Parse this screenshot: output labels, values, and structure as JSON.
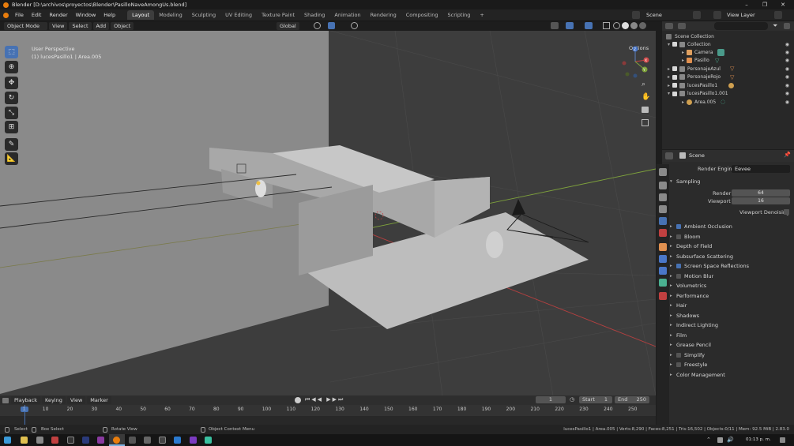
{
  "window": {
    "title": "Blender [D:\\archivos\\proyectos\\Blender\\PasilloNaveAmongUs.blend]",
    "controls": [
      "–",
      "❐",
      "✕"
    ]
  },
  "menubar": {
    "menus": [
      "File",
      "Edit",
      "Render",
      "Window",
      "Help"
    ],
    "workspaces": [
      "Layout",
      "Modeling",
      "Sculpting",
      "UV Editing",
      "Texture Paint",
      "Shading",
      "Animation",
      "Rendering",
      "Compositing",
      "Scripting"
    ],
    "active_workspace": "Layout",
    "add_tab": "+",
    "scene_name": "Scene",
    "view_layer": "View Layer"
  },
  "viewport": {
    "mode": "Object Mode",
    "menus": [
      "View",
      "Select",
      "Add",
      "Object"
    ],
    "transform_orientation": "Global",
    "options_label": "Options",
    "overlay_text_1": "User Perspective",
    "overlay_text_2": "(1) lucesPasillo1 | Area.005",
    "gizmo_axes": {
      "x": "X",
      "y": "Y",
      "z": "Z"
    }
  },
  "outliner": {
    "root": "Scene Collection",
    "rows": [
      {
        "name": "Collection",
        "indent": 1
      },
      {
        "name": "Camera",
        "indent": 2
      },
      {
        "name": "Pasillo",
        "indent": 2
      },
      {
        "name": "PersonajeAzul",
        "indent": 1
      },
      {
        "name": "PersonajeRojo",
        "indent": 1
      },
      {
        "name": "lucesPasillo1",
        "indent": 1
      },
      {
        "name": "lucesPasillo1.001",
        "indent": 1
      },
      {
        "name": "Area.005",
        "indent": 2
      }
    ]
  },
  "properties": {
    "header": "Scene",
    "render_engine_label": "Render Engine",
    "render_engine_value": "Eevee",
    "sampling_label": "Sampling",
    "render_label": "Render",
    "render_value": "64",
    "viewport_label": "Viewport",
    "viewport_value": "16",
    "viewport_denoising": "Viewport Denoising",
    "panels": [
      {
        "label": "Ambient Occlusion",
        "checkbox": true,
        "checked": true
      },
      {
        "label": "Bloom",
        "checkbox": true,
        "checked": false
      },
      {
        "label": "Depth of Field",
        "checkbox": false
      },
      {
        "label": "Subsurface Scattering",
        "checkbox": false
      },
      {
        "label": "Screen Space Reflections",
        "checkbox": true,
        "checked": true
      },
      {
        "label": "Motion Blur",
        "checkbox": true,
        "checked": false
      },
      {
        "label": "Volumetrics",
        "checkbox": false
      },
      {
        "label": "Performance",
        "checkbox": false
      },
      {
        "label": "Hair",
        "checkbox": false
      },
      {
        "label": "Shadows",
        "checkbox": false
      },
      {
        "label": "Indirect Lighting",
        "checkbox": false
      },
      {
        "label": "Film",
        "checkbox": false
      },
      {
        "label": "Grease Pencil",
        "checkbox": false
      },
      {
        "label": "Simplify",
        "checkbox": true,
        "checked": false
      },
      {
        "label": "Freestyle",
        "checkbox": true,
        "checked": false
      },
      {
        "label": "Color Management",
        "checkbox": false
      }
    ]
  },
  "timeline": {
    "menus": [
      "Playback",
      "Keying",
      "View",
      "Marker"
    ],
    "current_frame": "1",
    "start_label": "Start",
    "start_value": "1",
    "end_label": "End",
    "end_value": "250",
    "ruler": [
      "1",
      "10",
      "20",
      "30",
      "40",
      "50",
      "60",
      "70",
      "80",
      "90",
      "100",
      "110",
      "120",
      "130",
      "140",
      "150",
      "160",
      "170",
      "180",
      "190",
      "200",
      "210",
      "220",
      "230",
      "240",
      "250"
    ]
  },
  "statusbar": {
    "select": "Select",
    "box_select": "Box Select",
    "rotate_view": "Rotate View",
    "context_menu": "Object Context Menu",
    "stats": "lucesPasillo1 | Area.005 | Verts:8,290 | Faces:8,251 | Tris:16,502 | Objects:0/11 | Mem: 92.5 MiB | 2.83.0"
  },
  "taskbar": {
    "time": "01:13 p. m."
  },
  "colors": {
    "accent": "#4772b3",
    "blender_orange": "#e87d0d",
    "axis_red": "#d04040",
    "axis_green": "#7fa33c"
  }
}
